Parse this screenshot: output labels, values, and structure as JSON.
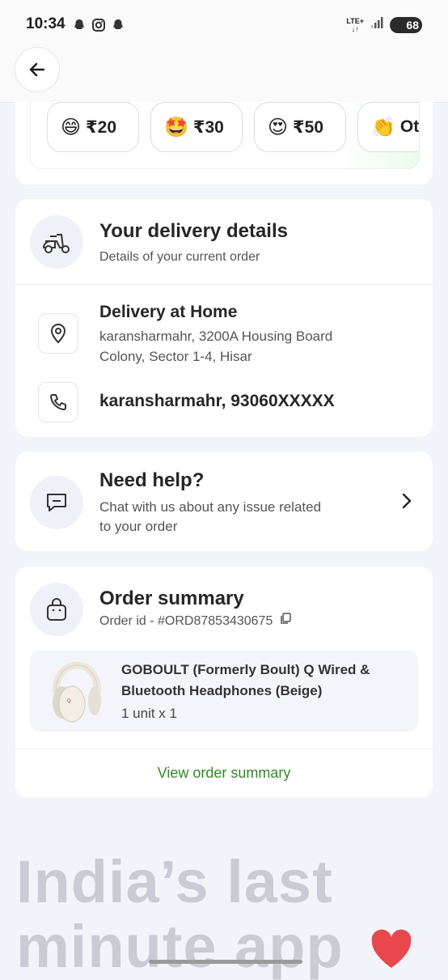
{
  "status_bar": {
    "time": "10:34",
    "network": "LTE+",
    "battery": "68",
    "icons": [
      "snapchat-icon",
      "instagram-icon",
      "snapchat-icon"
    ]
  },
  "header": {
    "back_icon": "arrow-left-icon"
  },
  "tips": [
    {
      "emoji": "😄",
      "amount": "₹20"
    },
    {
      "emoji": "🤩",
      "amount": "₹30"
    },
    {
      "emoji": "😍",
      "amount": "₹50"
    },
    {
      "emoji": "👏",
      "amount": "Ot"
    }
  ],
  "delivery": {
    "title": "Your delivery details",
    "subtitle": "Details of your current order",
    "location_title": "Delivery at Home",
    "address_line1": "karansharmahr, 3200A Housing Board",
    "address_line2": "Colony, Sector 1-4, Hisar",
    "contact": "karansharmahr, 93060XXXXX"
  },
  "help": {
    "title": "Need help?",
    "subtitle_line1": "Chat with us about any issue related",
    "subtitle_line2": "to your order"
  },
  "order": {
    "title": "Order summary",
    "order_id": "Order id - #ORD87853430675",
    "product_line1": "GOBOULT (Formerly Boult) Q Wired &",
    "product_line2": "Bluetooth Headphones (Beige)",
    "quantity": "1 unit x 1",
    "view_link": "View order summary"
  },
  "tagline": {
    "line1": "India’s last",
    "line2": "minute app"
  },
  "colors": {
    "accent_green": "#2f8b1f",
    "heart": "#e8474c",
    "tagline": "#c9ccd4"
  }
}
